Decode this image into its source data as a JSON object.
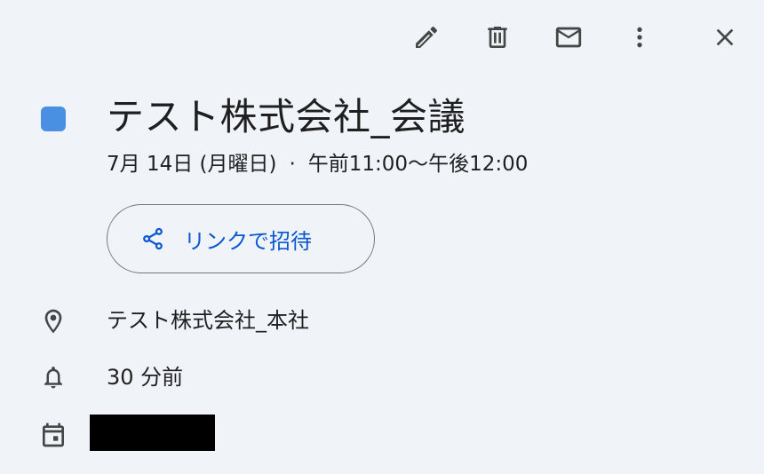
{
  "toolbar": {
    "edit_icon": "pencil-icon",
    "delete_icon": "trash-icon",
    "email_icon": "mail-icon",
    "more_icon": "more-vert-icon",
    "close_icon": "close-icon"
  },
  "event": {
    "color": "#4a90e2",
    "title": "テスト株式会社_会議",
    "date": "7月 14日 (月曜日)",
    "separator": "·",
    "time": "午前11:00～午後12:00"
  },
  "invite": {
    "label": "リンクで招待",
    "icon": "share-icon"
  },
  "details": {
    "location": "テスト株式会社_本社",
    "reminder": "30 分前",
    "calendar_icon": "calendar-icon"
  },
  "colors": {
    "accent": "#0b57d0",
    "icon": "#444746",
    "background": "#f0f4f9"
  }
}
